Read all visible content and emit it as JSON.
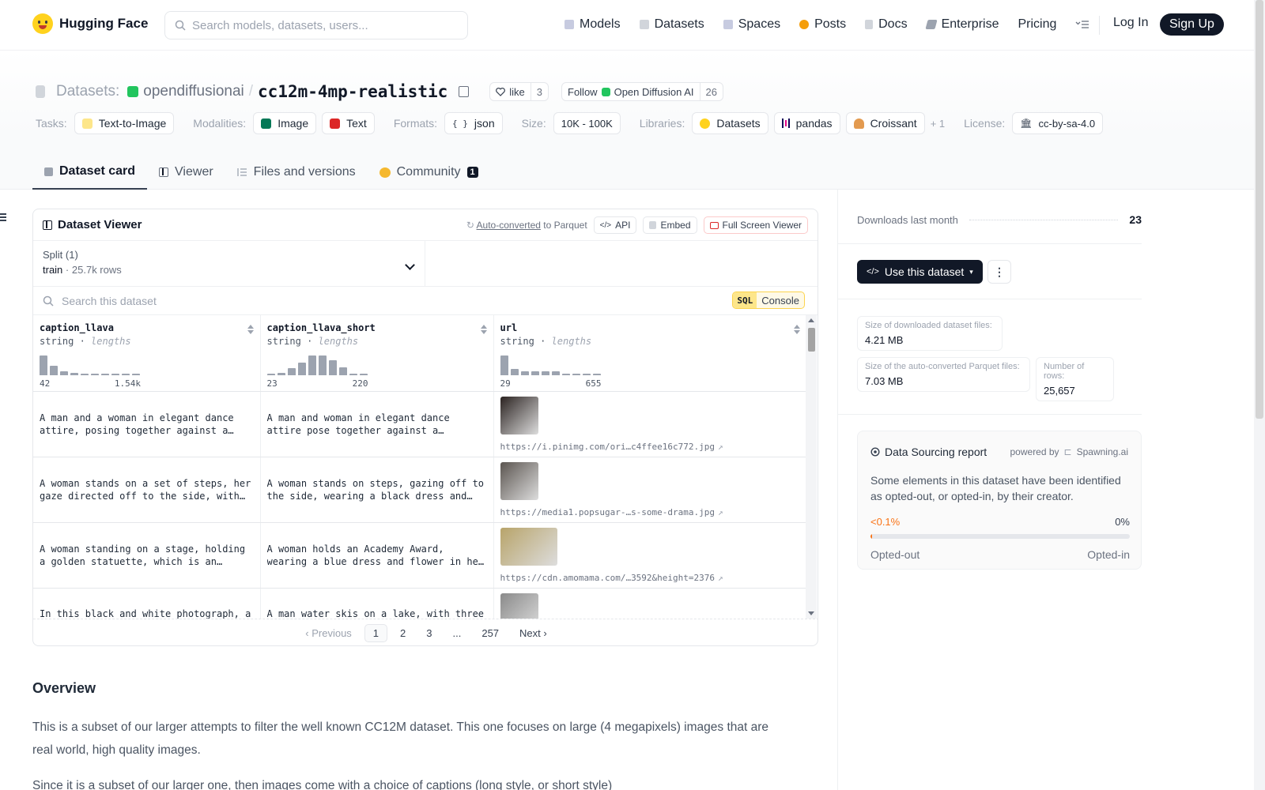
{
  "nav": {
    "brand": "Hugging Face",
    "search_placeholder": "Search models, datasets, users...",
    "links": [
      "Models",
      "Datasets",
      "Spaces",
      "Posts",
      "Docs",
      "Enterprise",
      "Pricing"
    ],
    "login": "Log In",
    "signup": "Sign Up"
  },
  "header": {
    "type_label": "Datasets:",
    "org": "opendiffusionai",
    "slash": "/",
    "repo": "cc12m-4mp-realistic",
    "like_label": "like",
    "like_count": "3",
    "follow_label": "Follow",
    "follow_org": "Open Diffusion AI",
    "follow_count": "26"
  },
  "tags": {
    "tasks_label": "Tasks:",
    "tasks": [
      "Text-to-Image"
    ],
    "modalities_label": "Modalities:",
    "modalities": [
      "Image",
      "Text"
    ],
    "formats_label": "Formats:",
    "formats": [
      "json"
    ],
    "size_label": "Size:",
    "size": "10K - 100K",
    "libraries_label": "Libraries:",
    "libraries": [
      "Datasets",
      "pandas",
      "Croissant"
    ],
    "more": "+ 1",
    "license_label": "License:",
    "license": "cc-by-sa-4.0"
  },
  "tabs": [
    {
      "label": "Dataset card"
    },
    {
      "label": "Viewer"
    },
    {
      "label": "Files and versions"
    },
    {
      "label": "Community",
      "badge": "1"
    }
  ],
  "viewer": {
    "title": "Dataset Viewer",
    "auto_converted": "Auto-converted",
    "to_parquet": "to Parquet",
    "api": "API",
    "embed": "Embed",
    "fullscreen": "Full Screen Viewer",
    "split_label": "Split (1)",
    "split_name": "train",
    "split_dot": "·",
    "split_rows": "25.7k rows",
    "search_placeholder": "Search this dataset",
    "sql": "SQL",
    "console": "Console",
    "columns": [
      {
        "name": "caption_llava",
        "type": "string",
        "sub": "lengths",
        "min": "42",
        "max": "1.54k",
        "hist": [
          0.95,
          0.45,
          0.2,
          0.12,
          0.06,
          0.06,
          0.06,
          0.06,
          0.06,
          0.06
        ]
      },
      {
        "name": "caption_llava_short",
        "type": "string",
        "sub": "lengths",
        "min": "23",
        "max": "220",
        "hist": [
          0.05,
          0.12,
          0.35,
          0.62,
          0.95,
          0.95,
          0.72,
          0.38,
          0.08,
          0.05
        ]
      },
      {
        "name": "url",
        "type": "string",
        "sub": "lengths",
        "min": "29",
        "max": "655",
        "hist": [
          0.95,
          0.3,
          0.18,
          0.18,
          0.18,
          0.18,
          0.06,
          0.06,
          0.06,
          0.06
        ]
      }
    ],
    "rows": [
      {
        "llava": "A man and a woman in elegant dance attire, posing together against a…",
        "short": "A man and woman in elegant dance attire pose together against a glittery…",
        "url": "https://i.pinimg.com/ori…c4ffee16c772.jpg",
        "thumb_color": "#2b2321"
      },
      {
        "llava": "A woman stands on a set of steps, her gaze directed off to the side, with a…",
        "short": "A woman stands on steps, gazing off to the side, wearing a black dress and…",
        "url": "https://media1.popsugar-…s-some-drama.jpg",
        "thumb_color": "#5b5550"
      },
      {
        "llava": "A woman standing on a stage, holding a golden statuette, which is an academy…",
        "short": "A woman holds an Academy Award, wearing a blue dress and flower in her hair, on…",
        "url": "https://cdn.amomama.com/…3592&height=2376",
        "thumb_color": "#b8a46a"
      },
      {
        "llava": "In this black and white photograph, a",
        "short": "A man water skis on a lake, with three",
        "url": "",
        "thumb_color": "#8a8a8a"
      }
    ],
    "pager": {
      "prev": "Previous",
      "pages": [
        "1",
        "2",
        "3",
        "...",
        "257"
      ],
      "next": "Next"
    }
  },
  "overview": {
    "title": "Overview",
    "p1": "This is a subset of our larger attempts to filter the well known CC12M dataset. This one focuses on large (4 megapixels) images that are real world, high quality images.",
    "p2": "Since it is a subset of our larger one, then images come with a choice of captions (long style, or short style)"
  },
  "sidebar": {
    "downloads_label": "Downloads last month",
    "downloads": "23",
    "use_dataset": "Use this dataset",
    "size_dl_label": "Size of downloaded dataset files:",
    "size_dl": "4.21 MB",
    "size_parquet_label": "Size of the auto-converted Parquet files:",
    "size_parquet": "7.03 MB",
    "rows_label": "Number of rows:",
    "rows": "25,657",
    "report_title": "Data Sourcing report",
    "powered_by": "powered by",
    "powered_name": "Spawning.ai",
    "report_desc": "Some elements in this dataset have been identified as opted-out, or opted-in, by their creator.",
    "opted_out_pct": "<0.1%",
    "opted_in_pct": "0%",
    "opted_out_fraction": 0.001,
    "opted_out_label": "Opted-out",
    "opted_in_label": "Opted-in"
  },
  "colors": {
    "accent_orange": "#f97316",
    "dark": "#111827",
    "brand_yellow": "#FFD21E"
  }
}
